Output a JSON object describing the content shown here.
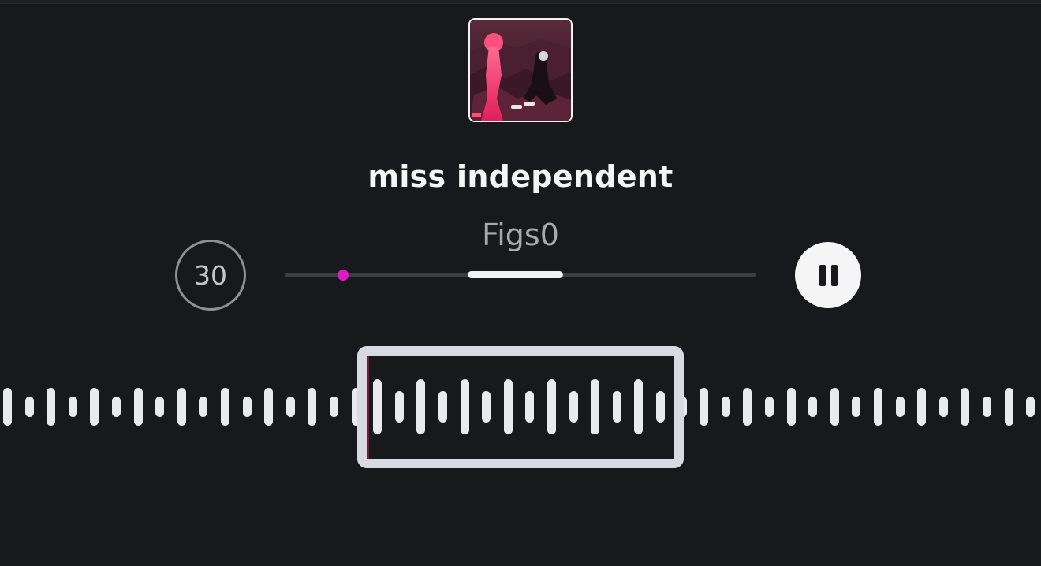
{
  "track": {
    "title": "miss independent",
    "artist": "Figs0"
  },
  "controls": {
    "skip_label": "30",
    "skip_icon": "skip-back-30-icon",
    "pause_icon": "pause-icon"
  },
  "timeline": {
    "playhead_fraction": 0.124,
    "clip_start_fraction": 0.388,
    "clip_end_fraction": 0.591,
    "playhead_color": "#e018c8"
  },
  "colors": {
    "background": "#18191d",
    "accent": "#e018c8",
    "waveform": "#e8eaee"
  }
}
